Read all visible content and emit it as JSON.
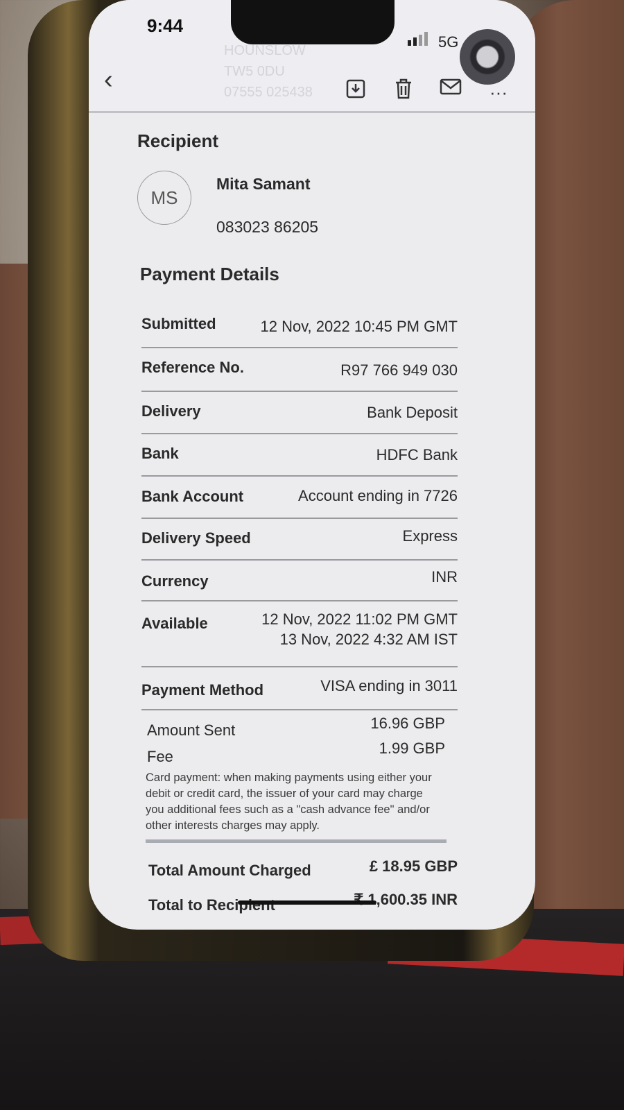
{
  "status_bar": {
    "time": "9:44",
    "network": "5G"
  },
  "ghost_text": [
    "HOUNSLOW",
    "TW5 0DU",
    "07555 025438"
  ],
  "toolbar": {
    "back_icon": "chevron-left-icon",
    "icons": [
      "download-icon",
      "trash-icon",
      "mail-icon",
      "more-icon"
    ]
  },
  "recipient": {
    "heading": "Recipient",
    "initials": "MS",
    "name": "Mita Samant",
    "account": "083023 86205"
  },
  "payment_details": {
    "heading": "Payment Details",
    "rows": [
      {
        "label": "Submitted",
        "value": "12 Nov, 2022 10:45 PM GMT"
      },
      {
        "label": "Reference No.",
        "value": "R97 766 949 030"
      },
      {
        "label": "Delivery",
        "value": "Bank Deposit"
      },
      {
        "label": "Bank",
        "value": "HDFC Bank"
      },
      {
        "label": "Bank Account",
        "value": "Account ending in 7726"
      },
      {
        "label": "Delivery Speed",
        "value": "Express"
      },
      {
        "label": "Currency",
        "value": "INR"
      },
      {
        "label": "Available",
        "value": "12 Nov, 2022 11:02 PM GMT",
        "value2": "13 Nov, 2022 4:32 AM IST"
      },
      {
        "label": "Payment Method",
        "value": "VISA ending in 3011"
      }
    ],
    "amount_sent_label": "Amount Sent",
    "amount_sent": "16.96 GBP",
    "fee_label": "Fee",
    "fee": "1.99 GBP",
    "note": "Card payment: when making payments using either your debit or credit card, the issuer of your card may charge you additional fees such as a \"cash advance fee\" and/or other interests charges may apply.",
    "total_charged_label": "Total Amount Charged",
    "total_charged": "£ 18.95 GBP",
    "total_recipient_label": "Total to Recipient",
    "total_recipient": "₹ 1,600.35 INR"
  }
}
